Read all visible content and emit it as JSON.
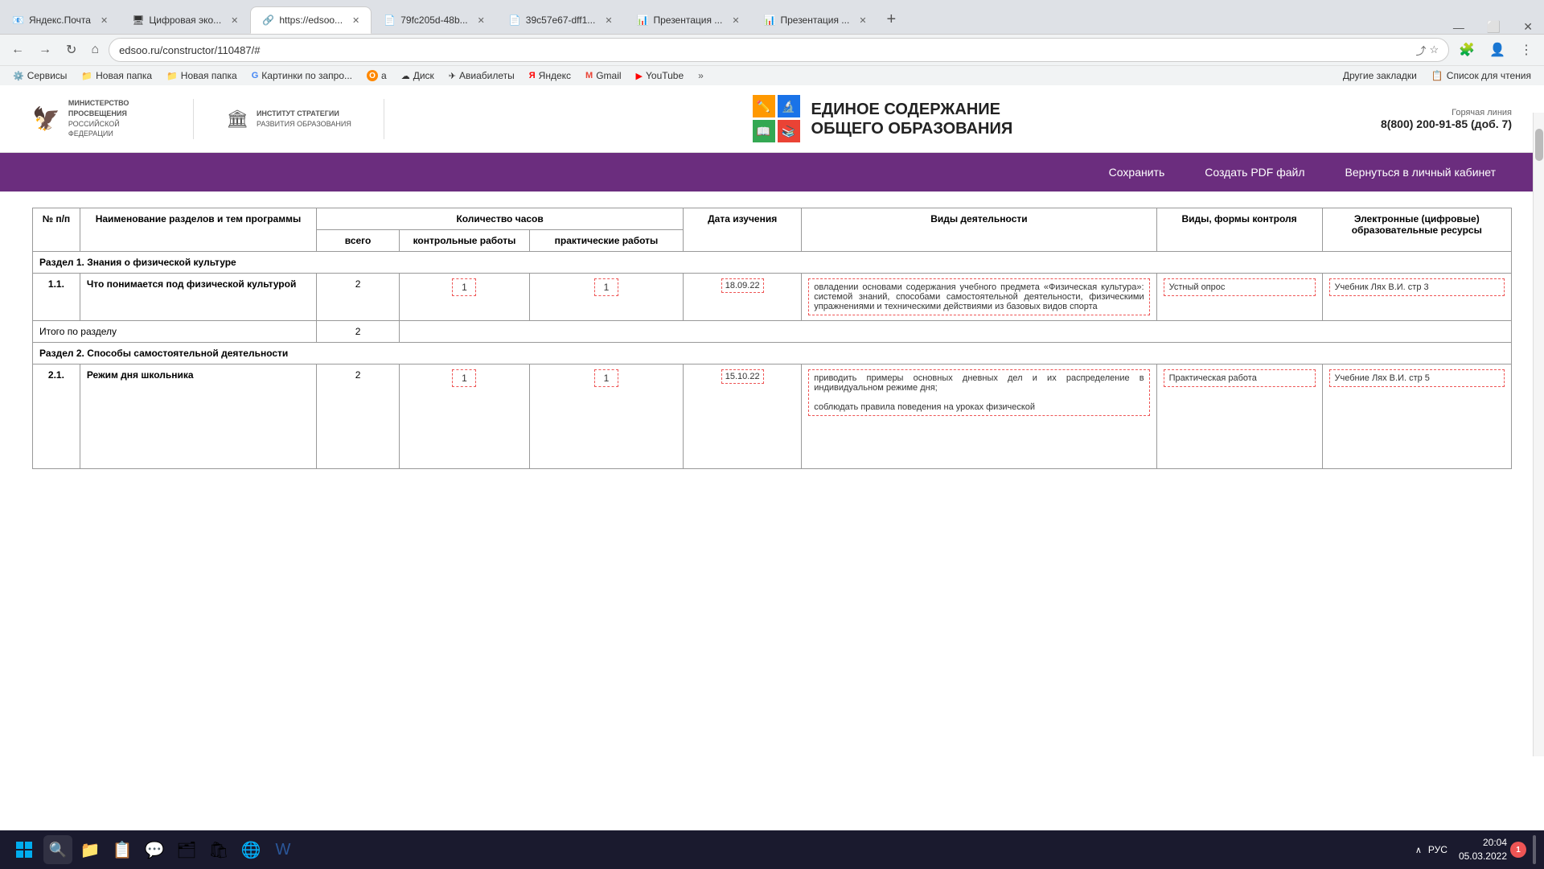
{
  "browser": {
    "tabs": [
      {
        "id": "tab1",
        "favicon": "📧",
        "label": "Яндекс.Почта",
        "active": false
      },
      {
        "id": "tab2",
        "favicon": "🖥",
        "label": "Цифровая эко...",
        "active": false
      },
      {
        "id": "tab3",
        "favicon": "🔗",
        "label": "https://edsoo...",
        "active": true
      },
      {
        "id": "tab4",
        "favicon": "📄",
        "label": "79fc205d-48b...",
        "active": false
      },
      {
        "id": "tab5",
        "favicon": "📄",
        "label": "39c57e67-dff1...",
        "active": false
      },
      {
        "id": "tab6",
        "favicon": "📊",
        "label": "Презентация ...",
        "active": false
      },
      {
        "id": "tab7",
        "favicon": "📊",
        "label": "Презентация ...",
        "active": false
      }
    ],
    "address": "edsoo.ru/constructor/110487/#",
    "bookmarks": [
      {
        "icon": "⚙️",
        "label": "Сервисы"
      },
      {
        "icon": "📁",
        "label": "Новая папка"
      },
      {
        "icon": "📁",
        "label": "Новая папка"
      },
      {
        "icon": "G",
        "label": "Картинки по запро..."
      },
      {
        "icon": "🅾",
        "label": "a"
      },
      {
        "icon": "☁",
        "label": "Диск"
      },
      {
        "icon": "✈",
        "label": "Авиабилеты"
      },
      {
        "icon": "Я",
        "label": "Яндекс"
      },
      {
        "icon": "M",
        "label": "Gmail"
      },
      {
        "icon": "▶",
        "label": "YouTube"
      }
    ],
    "other_bookmarks": "Другие закладки",
    "reading_list": "Список для чтения"
  },
  "site": {
    "ministry_line1": "МИНИСТЕРСТВО ПРОСВЕЩЕНИЯ",
    "ministry_line2": "РОССИЙСКОЙ ФЕДЕРАЦИИ",
    "institute_line1": "ИНСТИТУТ СТРАТЕГИИ",
    "institute_line2": "РАЗВИТИЯ ОБРАЗОВАНИЯ",
    "title_line1": "ЕДИНОЕ СОДЕРЖАНИЕ",
    "title_line2": "ОБЩЕГО ОБРАЗОВАНИЯ",
    "hotline_label": "Горячая линия",
    "hotline_number": "8(800) 200-91-85",
    "hotline_ext": "(доб. 7)"
  },
  "nav": {
    "save": "Сохранить",
    "create_pdf": "Создать PDF файл",
    "back_to_cabinet": "Вернуться в личный кабинет"
  },
  "table": {
    "headers": {
      "num": "№ п/п",
      "name": "Наименование разделов и тем программы",
      "hours_group": "Количество часов",
      "hours_total": "всего",
      "hours_control": "контрольные работы",
      "hours_practice": "практические работы",
      "date": "Дата изучения",
      "activities": "Виды деятельности",
      "forms": "Виды, формы контроля",
      "resources": "Электронные (цифровые) образовательные ресурсы"
    },
    "section1": {
      "title": "Раздел 1. Знания о физической культуре",
      "rows": [
        {
          "num": "1.1.",
          "name": "Что понимается под физической культурой",
          "total": "2",
          "control": "1",
          "practice": "1",
          "date": "18.09.22",
          "activities": "овладении основами содержания учебного предмета «Физическая культура»: системой знаний, способами самостоятельной деятельности, физическими упражнениями и техническими действиями из базовых видов спорта",
          "forms": "Устный опрос",
          "resources": "Учебник Лях В.И. стр 3"
        }
      ],
      "total_label": "Итого по разделу",
      "total_hours": "2"
    },
    "section2": {
      "title": "Раздел 2. Способы самостоятельной деятельности",
      "rows": [
        {
          "num": "2.1.",
          "name": "Режим дня школьника",
          "total": "2",
          "control": "1",
          "practice": "1",
          "date": "15.10.22",
          "activities": "приводить примеры основных дневных дел и их распределение в индивидуальном режиме дня;\n\nсоблюдать правила поведения на уроках физической",
          "forms": "Практическая работа",
          "resources": "Учебние Лях В.И. стр 5"
        }
      ]
    }
  },
  "taskbar": {
    "time": "20:04",
    "date": "05.03.2022",
    "notification_count": "1",
    "language": "РУС"
  }
}
